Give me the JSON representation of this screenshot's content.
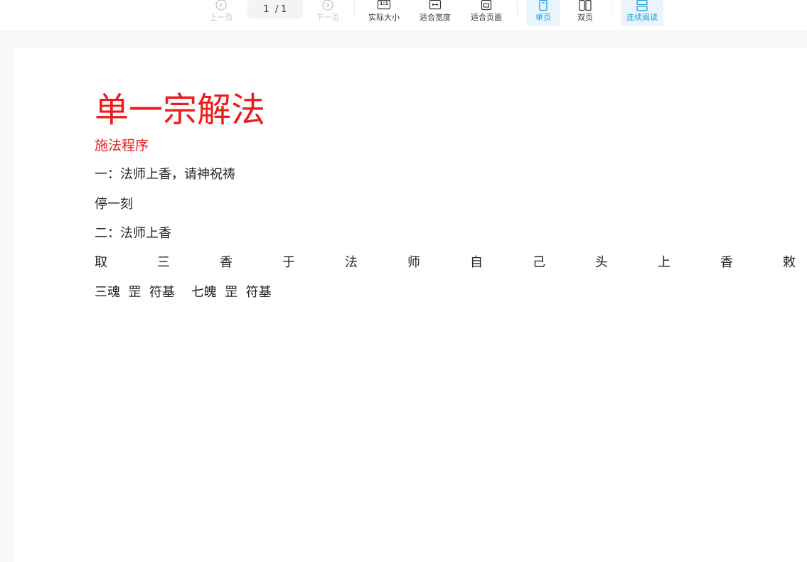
{
  "toolbar": {
    "prev_label": "上一页",
    "page_current": "1",
    "page_sep": "/",
    "page_total": "1",
    "next_label": "下一页",
    "actual_size_label": "实际大小",
    "actual_size_icon_text": "1:1",
    "fit_width_label": "适合宽度",
    "fit_page_label": "适合页面",
    "single_page_label": "单页",
    "double_page_label": "双页",
    "continuous_label": "连续阅读"
  },
  "colors": {
    "accent": "#1e9fd8",
    "title_red": "#ee1b1b",
    "disabled": "#c0c4cc"
  },
  "document": {
    "title": "单一宗解法",
    "subtitle": "施法程序",
    "lines": [
      "一：法师上香，请神祝祷",
      "停一刻",
      "二：法师上香"
    ],
    "spread_chars": [
      "取",
      "三",
      "香",
      "于",
      "法",
      "师",
      "自",
      "己",
      "头",
      "上",
      "香",
      "敕"
    ],
    "last_line": "三魂  罡  符基    七魄  罡  符基"
  }
}
